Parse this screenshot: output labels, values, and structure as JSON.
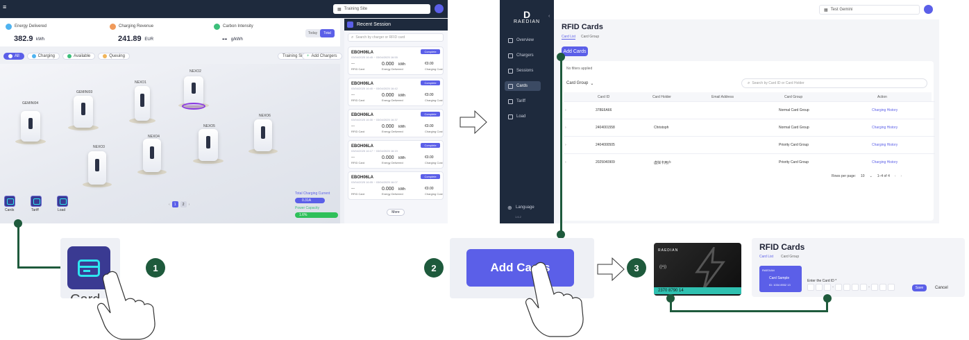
{
  "dashboard": {
    "site_selector": "Training Site",
    "stats": [
      {
        "label": "Energy Delivered",
        "value": "382.9",
        "unit": "kWh",
        "color": "#4fb3f0"
      },
      {
        "label": "Charging Revenue",
        "value": "241.89",
        "unit": "EUR",
        "color": "#f09a5a"
      },
      {
        "label": "Carbon Intensity",
        "value": "--",
        "unit": "g/kWh",
        "color": "#3cbf7a"
      }
    ],
    "period_today": "Today",
    "period_total": "Total",
    "filters": [
      {
        "label": "All",
        "active": true,
        "color": "#5b5fe8"
      },
      {
        "label": "Charging",
        "color": "#4fb3f0"
      },
      {
        "label": "Available",
        "color": "#3cbf7a"
      },
      {
        "label": "Queuing",
        "color": "#f0b45a"
      }
    ],
    "training_site_btn": "Training Site",
    "add_chargers_btn": "Add Chargers",
    "chargers": [
      "GEMINI04",
      "GEMINI03",
      "NEXO1",
      "NEXO2",
      "NEXO3",
      "NEXO4",
      "NEXO5",
      "NEXO6"
    ],
    "bottom_tools": [
      "Cards",
      "Tariff",
      "Load"
    ],
    "pages": [
      "1",
      "2"
    ],
    "total_charging_current_label": "Total Charging Current",
    "total_charging_current_value": "0.31A",
    "power_capacity_label": "Power Capacity",
    "power_capacity_value": "1.6%",
    "power_capacity_fraction": 0.016,
    "recent_session_title": "Recent Session",
    "search_placeholder": "Search by charger or RFID card",
    "sessions": [
      {
        "id": "EBOH06LA",
        "date": "03/04/2025 16:45 ~ 03/04/2025 16:55",
        "badge": "Complete",
        "card": "---",
        "card_label": "RFID Card",
        "energy": "0.000",
        "energy_unit": "kWh",
        "energy_label": "Energy Delivered",
        "cost": "€0.00",
        "cost_label": "Charging Cost"
      },
      {
        "id": "EBOH06LA",
        "date": "03/04/2025 16:40 ~ 03/04/2025 16:42",
        "badge": "Complete",
        "card": "---",
        "card_label": "RFID Card",
        "energy": "0.000",
        "energy_unit": "kWh",
        "energy_label": "Energy Delivered",
        "cost": "€0.00",
        "cost_label": "Charging Cost"
      },
      {
        "id": "EBOH06LA",
        "date": "03/04/2025 16:30 ~ 03/04/2025 16:37",
        "badge": "Complete",
        "card": "---",
        "card_label": "RFID Card",
        "energy": "0.000",
        "energy_unit": "kWh",
        "energy_label": "Energy Delivered",
        "cost": "€0.00",
        "cost_label": "Charging Cost"
      },
      {
        "id": "EBOH06LA",
        "date": "03/04/2025 16:17 ~ 03/04/2025 16:19",
        "badge": "Complete",
        "card": "---",
        "card_label": "RFID Card",
        "energy": "0.000",
        "energy_unit": "kWh",
        "energy_label": "Energy Delivered",
        "cost": "€0.00",
        "cost_label": "Charging Cost"
      },
      {
        "id": "EBOH06LA",
        "date": "03/04/2025 16:05 ~ 03/04/2025 16:07",
        "badge": "Complete",
        "card": "---",
        "card_label": "RFID Card",
        "energy": "0.000",
        "energy_unit": "kWh",
        "energy_label": "Energy Delivered",
        "cost": "€0.00",
        "cost_label": "Charging Cost"
      }
    ],
    "more_btn": "More"
  },
  "zoom1": {
    "label": "Card"
  },
  "rfid_page": {
    "brand": "RAEDIAN",
    "site_selector": "Test Gemini",
    "nav": [
      "Overview",
      "Chargers",
      "Sessions",
      "Cards",
      "Tariff",
      "Load"
    ],
    "nav_active": "Cards",
    "language": "Language",
    "version": "1.6.2",
    "title": "RFID Cards",
    "tabs": [
      "Card List",
      "Card Group"
    ],
    "add_cards_btn": "Add Cards",
    "no_filters": "No filters applied",
    "card_group_filter": "Card Group",
    "search_placeholder": "Search by Card ID or Card Holder",
    "columns": [
      "Card ID",
      "Card Holder",
      "Email Address",
      "Card Group",
      "Action"
    ],
    "rows": [
      {
        "card_id": "378E6A66",
        "holder": "",
        "email": "",
        "group": "Normal Card Group",
        "action": "Charging History"
      },
      {
        "card_id": "2404001558",
        "holder": "Christoph",
        "email": "",
        "group": "Normal Card Group",
        "action": "Charging History"
      },
      {
        "card_id": "2404000505",
        "holder": "",
        "email": "",
        "group": "Priority Card Group",
        "action": "Charging History"
      },
      {
        "card_id": "2025040909",
        "holder": "虚拟卡用户",
        "email": "",
        "group": "Priority Card Group",
        "action": "Charging History"
      }
    ],
    "rows_per_page_label": "Rows per page:",
    "rows_per_page": "10",
    "range": "1–4 of 4"
  },
  "zoom2": {
    "label": "Add Cards"
  },
  "step_numbers": [
    "1",
    "2",
    "3"
  ],
  "card_panel": {
    "card_brand": "RAEDIAN",
    "card_number": "2370 8790 14",
    "title": "RFID Cards",
    "tabs": [
      "Card List",
      "Card Group"
    ],
    "sample_brand": "RAEDIAN",
    "sample_label": "Card Sample",
    "sample_id": "ID: 1034 8932 13",
    "enter_label": "Enter the Card ID *",
    "save_btn": "Save",
    "cancel_btn": "Cancel"
  },
  "colors": {
    "accent": "#5b5fe8",
    "guide": "#1e5a3c",
    "sidebar": "#1e2a3d",
    "teal": "#2fc0b0"
  }
}
